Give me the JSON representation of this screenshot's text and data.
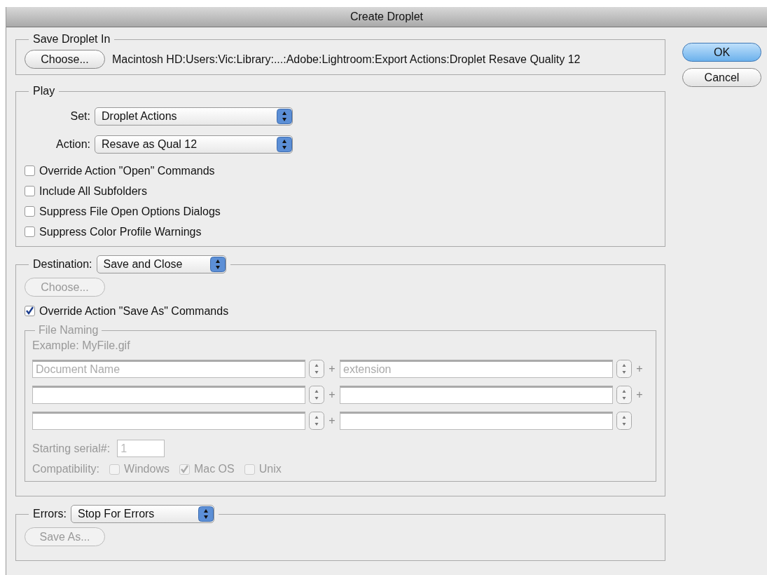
{
  "window": {
    "title": "Create Droplet"
  },
  "buttons": [
    {
      "label": "OK",
      "default": true
    },
    {
      "label": "Cancel",
      "default": false
    }
  ],
  "save_in": {
    "title": "Save Droplet In",
    "choose_button": {
      "label": "Choose...",
      "disabled": false
    },
    "path": "Macintosh HD:Users:Vic:Library:...:Adobe:Lightroom:Export Actions:Droplet Resave Quality 12"
  },
  "play": {
    "title": "Play",
    "selects": [
      {
        "label": "Set:",
        "value": "Droplet Actions"
      },
      {
        "label": "Action:",
        "value": "Resave as Qual 12"
      }
    ],
    "options": [
      {
        "label": "Override Action \"Open\" Commands",
        "checked": false
      },
      {
        "label": "Include All Subfolders",
        "checked": false
      },
      {
        "label": "Suppress File Open Options Dialogs",
        "checked": false
      },
      {
        "label": "Suppress Color Profile Warnings",
        "checked": false
      }
    ]
  },
  "destination": {
    "label": "Destination:",
    "value": "Save and Close",
    "choose_button": {
      "label": "Choose...",
      "disabled": true
    },
    "override": {
      "label": "Override Action \"Save As\" Commands",
      "checked": true
    },
    "file_naming": {
      "title": "File Naming",
      "disabled": true,
      "example": "Example: MyFile.gif",
      "rows": [
        {
          "values": [
            "Document Name",
            "extension"
          ],
          "joiners": [
            "+",
            "+"
          ]
        },
        {
          "joiners": [
            "+",
            "+"
          ]
        },
        {
          "joiners": [
            "+"
          ]
        }
      ],
      "serial": {
        "label": "Starting serial#:",
        "value": "1"
      },
      "compatibility": {
        "label": "Compatibility:",
        "options": [
          {
            "label": "Windows",
            "checked": false
          },
          {
            "label": "Mac OS",
            "checked": true
          },
          {
            "label": "Unix",
            "checked": false
          }
        ]
      }
    }
  },
  "errors": {
    "label": "Errors:",
    "value": "Stop For Errors",
    "save_as_button": {
      "label": "Save As...",
      "disabled": true
    }
  }
}
